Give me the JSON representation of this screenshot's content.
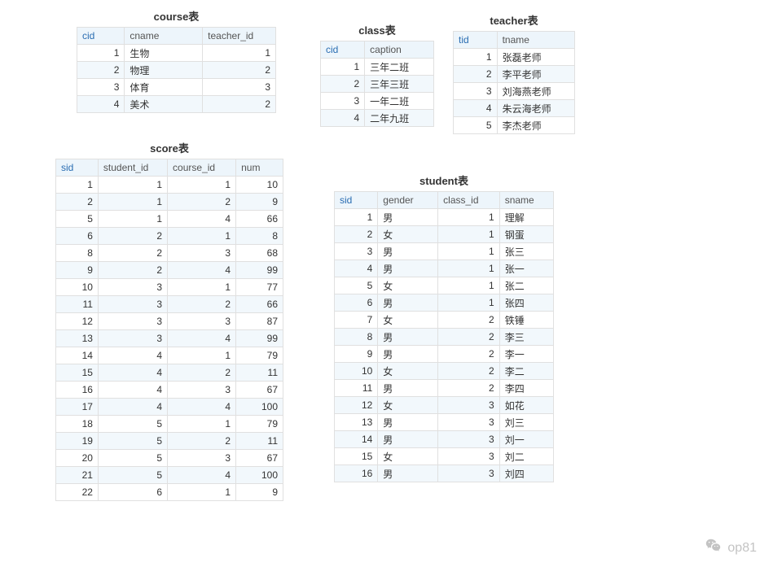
{
  "tables": {
    "course": {
      "title": "course表",
      "headers": [
        "cid",
        "cname",
        "teacher_id"
      ],
      "rows": [
        [
          "1",
          "生物",
          "1"
        ],
        [
          "2",
          "物理",
          "2"
        ],
        [
          "3",
          "体育",
          "3"
        ],
        [
          "4",
          "美术",
          "2"
        ]
      ],
      "numericCols": [
        0,
        2
      ]
    },
    "class": {
      "title": "class表",
      "headers": [
        "cid",
        "caption"
      ],
      "rows": [
        [
          "1",
          "三年二班"
        ],
        [
          "2",
          "三年三班"
        ],
        [
          "3",
          "一年二班"
        ],
        [
          "4",
          "二年九班"
        ]
      ],
      "numericCols": [
        0
      ]
    },
    "teacher": {
      "title": "teacher表",
      "headers": [
        "tid",
        "tname"
      ],
      "rows": [
        [
          "1",
          "张磊老师"
        ],
        [
          "2",
          "李平老师"
        ],
        [
          "3",
          "刘海燕老师"
        ],
        [
          "4",
          "朱云海老师"
        ],
        [
          "5",
          "李杰老师"
        ]
      ],
      "numericCols": [
        0
      ]
    },
    "score": {
      "title": "score表",
      "headers": [
        "sid",
        "student_id",
        "course_id",
        "num"
      ],
      "rows": [
        [
          "1",
          "1",
          "1",
          "10"
        ],
        [
          "2",
          "1",
          "2",
          "9"
        ],
        [
          "5",
          "1",
          "4",
          "66"
        ],
        [
          "6",
          "2",
          "1",
          "8"
        ],
        [
          "8",
          "2",
          "3",
          "68"
        ],
        [
          "9",
          "2",
          "4",
          "99"
        ],
        [
          "10",
          "3",
          "1",
          "77"
        ],
        [
          "11",
          "3",
          "2",
          "66"
        ],
        [
          "12",
          "3",
          "3",
          "87"
        ],
        [
          "13",
          "3",
          "4",
          "99"
        ],
        [
          "14",
          "4",
          "1",
          "79"
        ],
        [
          "15",
          "4",
          "2",
          "11"
        ],
        [
          "16",
          "4",
          "3",
          "67"
        ],
        [
          "17",
          "4",
          "4",
          "100"
        ],
        [
          "18",
          "5",
          "1",
          "79"
        ],
        [
          "19",
          "5",
          "2",
          "11"
        ],
        [
          "20",
          "5",
          "3",
          "67"
        ],
        [
          "21",
          "5",
          "4",
          "100"
        ],
        [
          "22",
          "6",
          "1",
          "9"
        ]
      ],
      "numericCols": [
        0,
        1,
        2,
        3
      ]
    },
    "student": {
      "title": "student表",
      "headers": [
        "sid",
        "gender",
        "class_id",
        "sname"
      ],
      "rows": [
        [
          "1",
          "男",
          "1",
          "理解"
        ],
        [
          "2",
          "女",
          "1",
          "钢蛋"
        ],
        [
          "3",
          "男",
          "1",
          "张三"
        ],
        [
          "4",
          "男",
          "1",
          "张一"
        ],
        [
          "5",
          "女",
          "1",
          "张二"
        ],
        [
          "6",
          "男",
          "1",
          "张四"
        ],
        [
          "7",
          "女",
          "2",
          "铁锤"
        ],
        [
          "8",
          "男",
          "2",
          "李三"
        ],
        [
          "9",
          "男",
          "2",
          "李一"
        ],
        [
          "10",
          "女",
          "2",
          "李二"
        ],
        [
          "11",
          "男",
          "2",
          "李四"
        ],
        [
          "12",
          "女",
          "3",
          "如花"
        ],
        [
          "13",
          "男",
          "3",
          "刘三"
        ],
        [
          "14",
          "男",
          "3",
          "刘一"
        ],
        [
          "15",
          "女",
          "3",
          "刘二"
        ],
        [
          "16",
          "男",
          "3",
          "刘四"
        ]
      ],
      "numericCols": [
        0,
        2
      ]
    }
  },
  "watermark": "op81",
  "chart_data": {
    "type": "table",
    "tables": [
      {
        "name": "course",
        "columns": [
          "cid",
          "cname",
          "teacher_id"
        ],
        "rows": [
          [
            1,
            "生物",
            1
          ],
          [
            2,
            "物理",
            2
          ],
          [
            3,
            "体育",
            3
          ],
          [
            4,
            "美术",
            2
          ]
        ]
      },
      {
        "name": "class",
        "columns": [
          "cid",
          "caption"
        ],
        "rows": [
          [
            1,
            "三年二班"
          ],
          [
            2,
            "三年三班"
          ],
          [
            3,
            "一年二班"
          ],
          [
            4,
            "二年九班"
          ]
        ]
      },
      {
        "name": "teacher",
        "columns": [
          "tid",
          "tname"
        ],
        "rows": [
          [
            1,
            "张磊老师"
          ],
          [
            2,
            "李平老师"
          ],
          [
            3,
            "刘海燕老师"
          ],
          [
            4,
            "朱云海老师"
          ],
          [
            5,
            "李杰老师"
          ]
        ]
      },
      {
        "name": "score",
        "columns": [
          "sid",
          "student_id",
          "course_id",
          "num"
        ],
        "rows": [
          [
            1,
            1,
            1,
            10
          ],
          [
            2,
            1,
            2,
            9
          ],
          [
            5,
            1,
            4,
            66
          ],
          [
            6,
            2,
            1,
            8
          ],
          [
            8,
            2,
            3,
            68
          ],
          [
            9,
            2,
            4,
            99
          ],
          [
            10,
            3,
            1,
            77
          ],
          [
            11,
            3,
            2,
            66
          ],
          [
            12,
            3,
            3,
            87
          ],
          [
            13,
            3,
            4,
            99
          ],
          [
            14,
            4,
            1,
            79
          ],
          [
            15,
            4,
            2,
            11
          ],
          [
            16,
            4,
            3,
            67
          ],
          [
            17,
            4,
            4,
            100
          ],
          [
            18,
            5,
            1,
            79
          ],
          [
            19,
            5,
            2,
            11
          ],
          [
            20,
            5,
            3,
            67
          ],
          [
            21,
            5,
            4,
            100
          ],
          [
            22,
            6,
            1,
            9
          ]
        ]
      },
      {
        "name": "student",
        "columns": [
          "sid",
          "gender",
          "class_id",
          "sname"
        ],
        "rows": [
          [
            1,
            "男",
            1,
            "理解"
          ],
          [
            2,
            "女",
            1,
            "钢蛋"
          ],
          [
            3,
            "男",
            1,
            "张三"
          ],
          [
            4,
            "男",
            1,
            "张一"
          ],
          [
            5,
            "女",
            1,
            "张二"
          ],
          [
            6,
            "男",
            1,
            "张四"
          ],
          [
            7,
            "女",
            2,
            "铁锤"
          ],
          [
            8,
            "男",
            2,
            "李三"
          ],
          [
            9,
            "男",
            2,
            "李一"
          ],
          [
            10,
            "女",
            2,
            "李二"
          ],
          [
            11,
            "男",
            2,
            "李四"
          ],
          [
            12,
            "女",
            3,
            "如花"
          ],
          [
            13,
            "男",
            3,
            "刘三"
          ],
          [
            14,
            "男",
            3,
            "刘一"
          ],
          [
            15,
            "女",
            3,
            "刘二"
          ],
          [
            16,
            "男",
            3,
            "刘四"
          ]
        ]
      }
    ]
  }
}
